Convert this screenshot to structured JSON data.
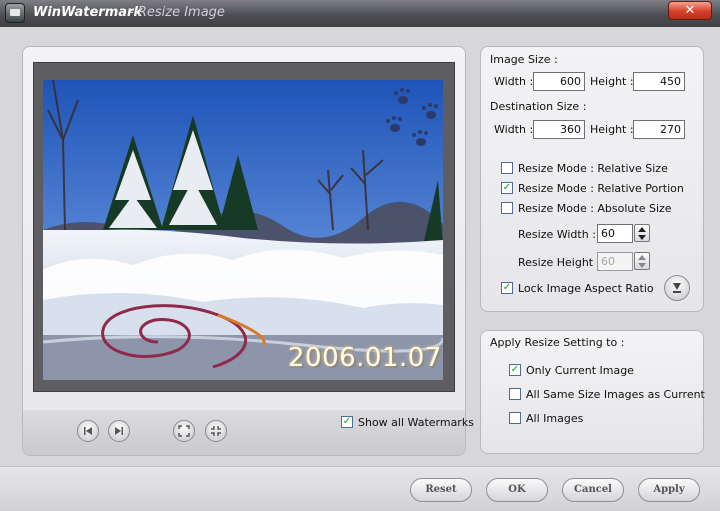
{
  "window": {
    "app_name": "WinWatermark",
    "subtitle": "- Resize Image",
    "close_glyph": "✕"
  },
  "preview": {
    "date_stamp": "2006.01.07",
    "show_all_watermarks_label": "Show all Watermarks",
    "show_all_watermarks_checked": true,
    "icons": [
      "first-page-icon",
      "next-page-icon",
      "fit-window-icon",
      "actual-size-icon"
    ]
  },
  "image_size": {
    "heading": "Image Size :",
    "width_label": "Width :",
    "width": "600",
    "height_label": "Height :",
    "height": "450"
  },
  "destination_size": {
    "heading": "Destination Size :",
    "width_label": "Width :",
    "width": "360",
    "height_label": "Height :",
    "height": "270"
  },
  "resize_modes": [
    {
      "label": "Resize Mode : Relative Size",
      "checked": false
    },
    {
      "label": "Resize Mode : Relative Portion",
      "checked": true
    },
    {
      "label": "Resize Mode : Absolute Size",
      "checked": false
    }
  ],
  "resize_width": {
    "label": "Resize Width :",
    "value": "60"
  },
  "resize_height": {
    "label": "Resize Height :",
    "value": "60"
  },
  "lock_ratio": {
    "label": "Lock Image Aspect Ratio",
    "checked": true
  },
  "apply": {
    "heading": "Apply Resize Setting to :",
    "options": [
      {
        "label": "Only Current Image",
        "checked": true
      },
      {
        "label": "All Same Size Images as Current",
        "checked": false
      },
      {
        "label": "All Images",
        "checked": false
      }
    ]
  },
  "footer": {
    "reset": "Reset",
    "ok": "OK",
    "cancel": "Cancel",
    "apply": "Apply"
  },
  "check_glyph": "✓",
  "colors": {
    "title_bar": "#4e4e55",
    "close_button": "#d5402a",
    "check_mark": "#1f9a1f",
    "sky": "#3f6fc8"
  }
}
